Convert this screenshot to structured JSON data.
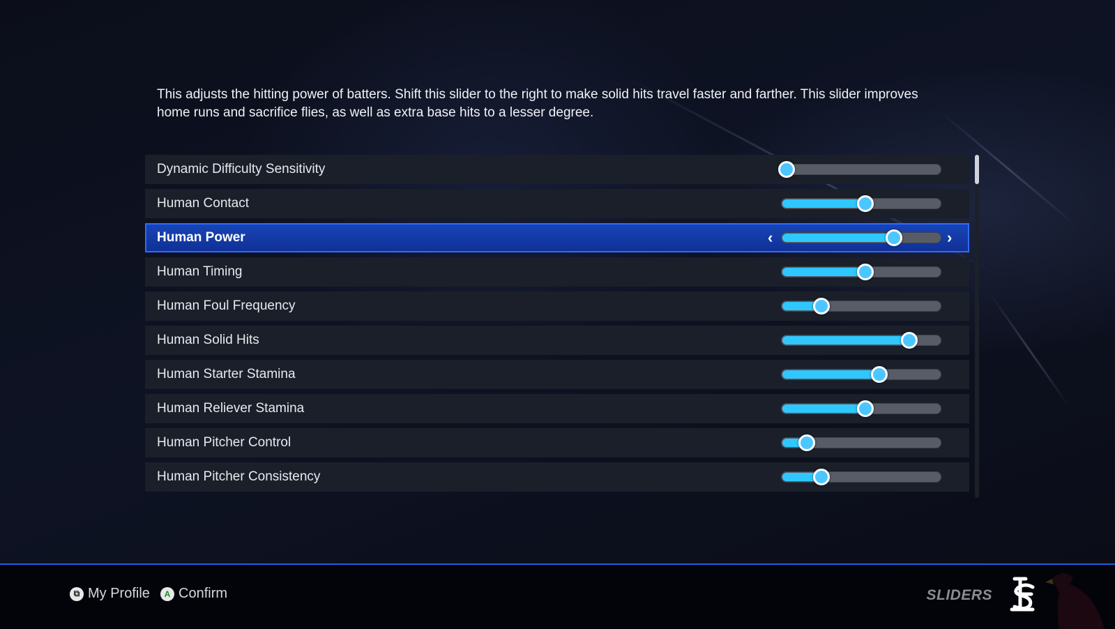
{
  "description": "This adjusts the hitting power of batters. Shift this slider to the right to make solid hits travel faster and farther. This slider improves home runs and sacrifice flies, as well as extra base hits to a lesser degree.",
  "sliders": [
    {
      "label": "Dynamic Difficulty Sensitivity",
      "value_percent": 0,
      "selected": false
    },
    {
      "label": "Human Contact",
      "value_percent": 50,
      "selected": false
    },
    {
      "label": "Human Power",
      "value_percent": 68,
      "selected": true
    },
    {
      "label": "Human Timing",
      "value_percent": 50,
      "selected": false
    },
    {
      "label": "Human Foul Frequency",
      "value_percent": 22,
      "selected": false
    },
    {
      "label": "Human Solid Hits",
      "value_percent": 78,
      "selected": false
    },
    {
      "label": "Human Starter Stamina",
      "value_percent": 59,
      "selected": false
    },
    {
      "label": "Human Reliever Stamina",
      "value_percent": 50,
      "selected": false
    },
    {
      "label": "Human Pitcher Control",
      "value_percent": 13,
      "selected": false
    },
    {
      "label": "Human Pitcher Consistency",
      "value_percent": 22,
      "selected": false
    }
  ],
  "selected_arrows": {
    "left": "‹",
    "right": "›"
  },
  "footer": {
    "hints": [
      {
        "button": "view-button",
        "glyph": "⧉",
        "label": "My Profile"
      },
      {
        "button": "a-button",
        "glyph": "A",
        "label": "Confirm"
      }
    ],
    "screen_title": "SLIDERS",
    "team_logo": "STL"
  },
  "colors": {
    "accent": "#2ec8ff",
    "selection": "#1846b8",
    "row_bg": "#1a1f29",
    "track": "#585c66",
    "footer_line": "#1f5fe0",
    "a_button_green": "#1e8a2e"
  }
}
